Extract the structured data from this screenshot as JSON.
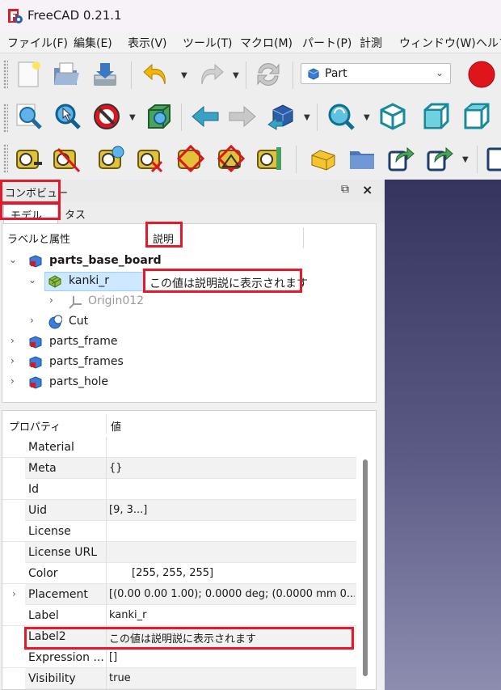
{
  "app": {
    "title": "FreeCAD 0.21.1"
  },
  "menu": [
    "ファイル(F)",
    "編集(E)",
    "表示(V)",
    "ツール(T)",
    "マクロ(M)",
    "パート(P)",
    "計測",
    "ウィンドウ(W)",
    "ヘルプ"
  ],
  "workbench": {
    "selected": "Part"
  },
  "combo": {
    "title": "コンボビュー",
    "tabs": [
      "モデル",
      "タスク"
    ]
  },
  "tree": {
    "col_label": "ラベルと属性",
    "col_desc": "説明",
    "items": [
      {
        "label": "parts_base_board",
        "bold": true
      },
      {
        "label": "kanki_r",
        "description": "この値は説明説に表示されます"
      },
      {
        "label": "Origin012"
      },
      {
        "label": "Cut"
      },
      {
        "label": "parts_frame"
      },
      {
        "label": "parts_frames"
      },
      {
        "label": "parts_hole"
      }
    ]
  },
  "props": {
    "col_prop": "プロパティ",
    "col_val": "値",
    "rows": [
      {
        "name": "Material",
        "value": ""
      },
      {
        "name": "Meta",
        "value": "{}"
      },
      {
        "name": "Id",
        "value": ""
      },
      {
        "name": "Uid",
        "value": "[9, 3...]"
      },
      {
        "name": "License",
        "value": ""
      },
      {
        "name": "License URL",
        "value": ""
      },
      {
        "name": "Color",
        "value": "[255, 255, 255]"
      },
      {
        "name": "Placement",
        "value": "[(0.00 0.00 1.00); 0.0000 deg; (0.0000 mm  0..."
      },
      {
        "name": "Label",
        "value": "kanki_r"
      },
      {
        "name": "Label2",
        "value": "この値は説明説に表示されます"
      },
      {
        "name": "Expression ...",
        "value": "[]"
      },
      {
        "name": "Visibility",
        "value": "true"
      }
    ]
  },
  "colors": {
    "highlight": "#e3192c",
    "selection": "#cde8ff"
  }
}
